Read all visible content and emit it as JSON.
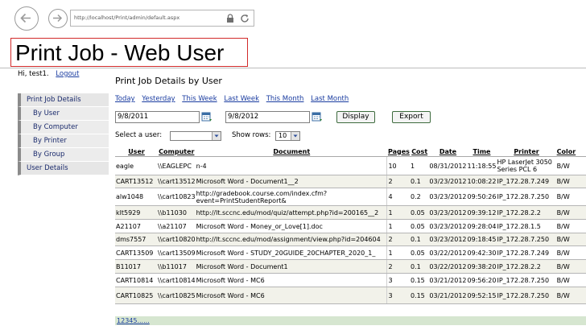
{
  "browser": {
    "url": "http://localhost/Print/admin/default.aspx"
  },
  "header": {
    "title": "Print Job - Web User",
    "greeting": "Hi, test1.",
    "logout": "Logout"
  },
  "sidebar": {
    "items": [
      {
        "label": "Print Job Details",
        "level": "main"
      },
      {
        "label": "By User",
        "level": "sub"
      },
      {
        "label": "By Computer",
        "level": "sub"
      },
      {
        "label": "By Printer",
        "level": "sub"
      },
      {
        "label": "By Group",
        "level": "sub"
      },
      {
        "label": "User Details",
        "level": "main"
      }
    ]
  },
  "main": {
    "section_title": "Print Job Details by User",
    "periods": [
      "Today",
      "Yesterday",
      "This Week",
      "Last Week",
      "This Month",
      "Last Month"
    ],
    "date_from": "9/8/2011",
    "date_to": "9/8/2012",
    "display_button": "Display",
    "export_button": "Export",
    "select_user_label": "Select a user:",
    "select_user_value": "",
    "show_rows_label": "Show rows:",
    "show_rows_value": "10"
  },
  "table": {
    "columns": [
      "User",
      "Computer",
      "Document",
      "Pages",
      "Cost",
      "Date",
      "Time",
      "Printer",
      "Color"
    ],
    "rows": [
      [
        "eagle",
        "\\\\EAGLEPC",
        "n-4",
        "10",
        "1",
        "08/31/2012",
        "11:18:55",
        "HP LaserJet 3050 Series PCL 6",
        "B/W"
      ],
      [
        "CART13512",
        "\\\\cart13512",
        "Microsoft Word - Document1__2",
        "2",
        "0.1",
        "03/23/2012",
        "10:08:22",
        "IP_172.28.7.249",
        "B/W"
      ],
      [
        "alw1048",
        "\\\\cart10823",
        "http://gradebook.course.com/index.cfm?event=PrintStudentReport&",
        "4",
        "0.2",
        "03/23/2012",
        "09:50:26",
        "IP_172.28.7.250",
        "B/W"
      ],
      [
        "klt5929",
        "\\\\b11030",
        "http://lt.sccnc.edu/mod/quiz/attempt.php?id=200165__2",
        "1",
        "0.05",
        "03/23/2012",
        "09:39:12",
        "IP_172.28.2.2",
        "B/W"
      ],
      [
        "A21107",
        "\\\\a21107",
        "Microsoft Word - Money_or_Love[1].doc",
        "1",
        "0.05",
        "03/23/2012",
        "09:28:04",
        "IP_172.28.1.5",
        "B/W"
      ],
      [
        "dms7557",
        "\\\\cart10820",
        "http://lt.sccnc.edu/mod/assignment/view.php?id=204604",
        "2",
        "0.1",
        "03/23/2012",
        "09:18:45",
        "IP_172.28.7.250",
        "B/W"
      ],
      [
        "CART13509",
        "\\\\cart13509",
        "Microsoft Word - STUDY_20GUIDE_20CHAPTER_2020_1_",
        "1",
        "0.05",
        "03/22/2012",
        "09:42:30",
        "IP_172.28.7.249",
        "B/W"
      ],
      [
        "B11017",
        "\\\\b11017",
        "Microsoft Word - Document1",
        "2",
        "0.1",
        "03/22/2012",
        "09:38:20",
        "IP_172.28.2.2",
        "B/W"
      ],
      [
        "CART10814",
        "\\\\cart10814",
        "Microsoft Word - MC6",
        "3",
        "0.15",
        "03/21/2012",
        "09:56:20",
        "IP_172.28.7.250",
        "B/W"
      ],
      [
        "CART10825",
        "\\\\cart10825",
        "Microsoft Word - MC6",
        "3",
        "0.15",
        "03/21/2012",
        "09:52:15",
        "IP_172.28.7.250",
        "B/W"
      ]
    ]
  },
  "pager": {
    "pages": [
      "1",
      "2",
      "3",
      "4",
      "5",
      "..."
    ],
    "more": "..."
  },
  "colors": {
    "title_border": "#d12a2a",
    "link": "#1a3ca0",
    "row_alt": "#f2f2ea",
    "pager_bg": "#d6e6d0"
  }
}
